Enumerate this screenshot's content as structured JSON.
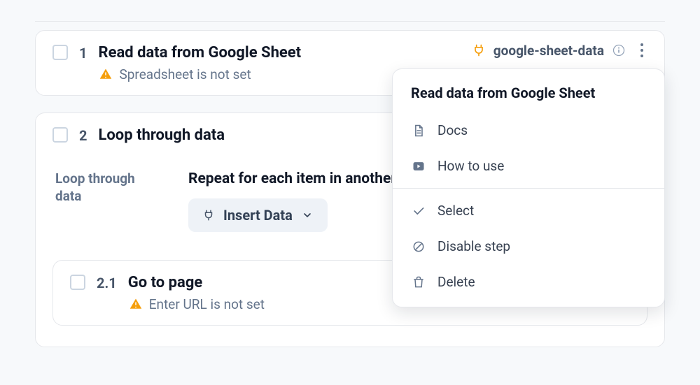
{
  "steps": {
    "s1": {
      "num": "1",
      "title": "Read data from Google Sheet",
      "warning": "Spreadsheet is not set",
      "integration_label": "google-sheet-data"
    },
    "s2": {
      "num": "2",
      "title": "Loop through data",
      "field_label": "Loop through data",
      "field_heading": "Repeat for each item in another",
      "insert_button_label": "Insert Data",
      "sub": {
        "num": "2.1",
        "title": "Go to page",
        "warning": "Enter URL is not set"
      }
    }
  },
  "menu": {
    "title": "Read data from Google Sheet",
    "items": {
      "docs": "Docs",
      "howto": "How to use",
      "select": "Select",
      "disable": "Disable step",
      "delete": "Delete"
    }
  },
  "colors": {
    "warn": "#f59e0b",
    "muted": "#64748b"
  }
}
